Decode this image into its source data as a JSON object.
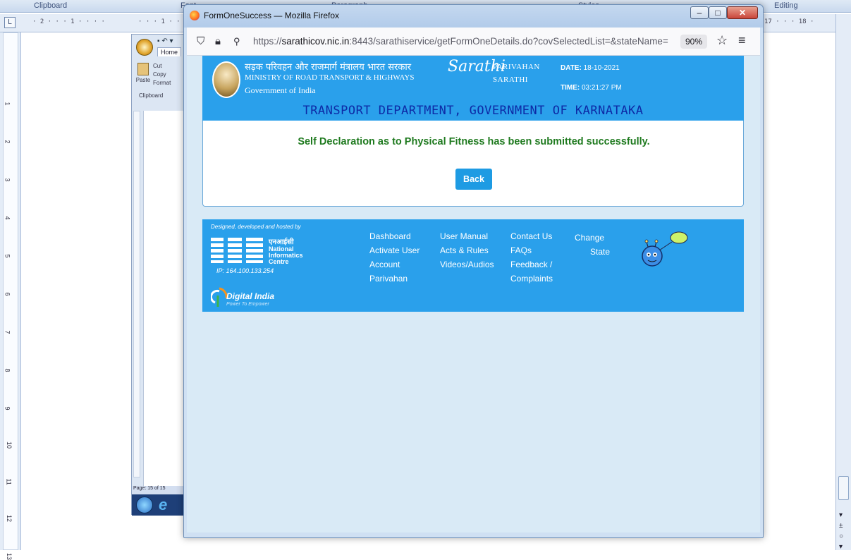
{
  "word": {
    "ribbon_groups": [
      "Clipboard",
      "Font",
      "Paragraph",
      "Styles",
      "Editing"
    ],
    "ruler_left_box": "L",
    "ruler_marks": "· 2 · · · 1 · · · ·",
    "ruler_marks_2": "· · · 1 · ·",
    "ruler_right_marks": "17 · · · 18 ·",
    "left_ruler_numbers": [
      "1",
      "2",
      "3",
      "4",
      "5",
      "6",
      "7",
      "8",
      "9",
      "10",
      "11",
      "12",
      "13"
    ],
    "inner": {
      "tab_home": "Home",
      "cut": "Cut",
      "copy": "Copy",
      "format": "Format",
      "paste": "Paste",
      "clipboard": "Clipboard",
      "status": "Page: 15 of 15"
    }
  },
  "firefox": {
    "window_title": "FormOneSuccess — Mozilla Firefox",
    "url_prefix": "https://",
    "url_host": "sarathicov.nic.in",
    "url_rest": ":8443/sarathiservice/getFormOneDetails.do?covSelectedList=&stateName=",
    "zoom": "90%",
    "icons": {
      "shield": "shield-icon",
      "lock": "lock-icon",
      "permissions": "permissions-icon",
      "star": "star-icon",
      "menu": "hamburger-menu-icon"
    }
  },
  "site": {
    "ministry_hindi": "सड़क परिवहन और राजमार्ग मंत्रालय भारत सरकार",
    "ministry_en": "MINISTRY OF ROAD TRANSPORT & HIGHWAYS",
    "gov_india": "Government of India",
    "sarathi_logo_text": "Sarathi",
    "parivahan_word": "PARIVAHAN",
    "sarathi_word": "SARATHI",
    "date_label": "DATE:",
    "date_value": "18-10-2021",
    "time_label": "TIME:",
    "time_value": "03:21:27 PM",
    "dept_banner": "TRANSPORT DEPARTMENT, GOVERNMENT OF KARNATAKA",
    "success_message": "Self Declaration as to Physical Fitness has been submitted successfully.",
    "back_button": "Back",
    "colors": {
      "header_blue": "#2aa0eb",
      "success_green": "#1f7a1f",
      "button_blue": "#1e9be3",
      "dept_text": "#0d2aa6"
    }
  },
  "footer": {
    "designed_by": "Designed, developed and hosted by",
    "nic_hindi": "एनआईसी",
    "nic_words": [
      "National",
      "Informatics",
      "Centre"
    ],
    "ip": "IP: 164.100.133.254",
    "digital_india": "Digital India",
    "digital_india_tag": "Power To Empower",
    "col1": [
      "Dashboard",
      "Activate User",
      "Account",
      "Parivahan"
    ],
    "col2": [
      "User Manual",
      "Acts & Rules",
      "Videos/Audios"
    ],
    "col3": [
      "Contact Us",
      "FAQs",
      "Feedback /",
      "Complaints"
    ],
    "col4": [
      "Change",
      "State"
    ]
  }
}
